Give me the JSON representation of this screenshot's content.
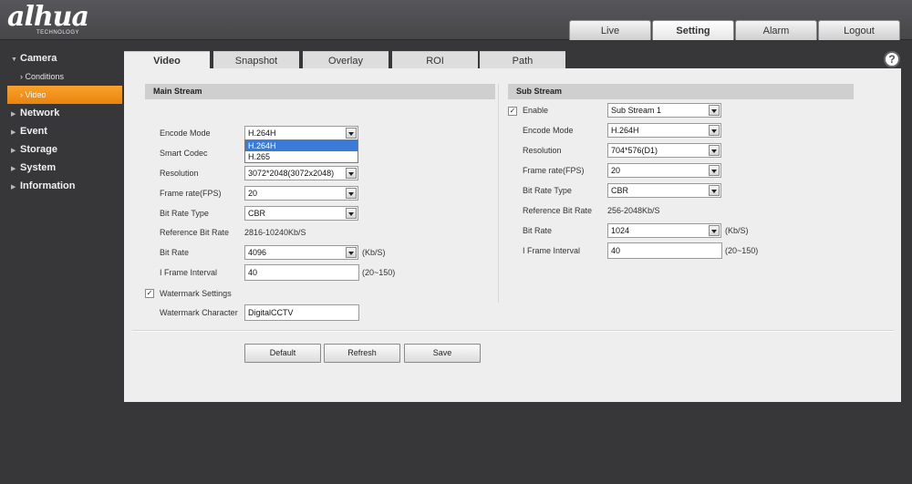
{
  "brand": {
    "logo": "alhua",
    "tagline": "TECHNOLOGY"
  },
  "top_nav": [
    "Live",
    "Setting",
    "Alarm",
    "Logout"
  ],
  "sidebar": {
    "camera": "Camera",
    "conditions": "Conditions",
    "video": "Video",
    "network": "Network",
    "event": "Event",
    "storage": "Storage",
    "system": "System",
    "information": "Information"
  },
  "tabs": [
    "Video",
    "Snapshot",
    "Overlay",
    "ROI",
    "Path"
  ],
  "help": "?",
  "main_stream": {
    "title": "Main Stream",
    "encode_mode_label": "Encode Mode",
    "encode_mode_value": "H.264H",
    "encode_options": [
      "H.264H",
      "H.265"
    ],
    "smart_codec_label": "Smart Codec",
    "resolution_label": "Resolution",
    "resolution_value": "3072*2048(3072x2048)",
    "frame_rate_label": "Frame rate(FPS)",
    "frame_rate_value": "20",
    "bit_rate_type_label": "Bit Rate Type",
    "bit_rate_type_value": "CBR",
    "ref_bit_rate_label": "Reference Bit Rate",
    "ref_bit_rate_value": "2816-10240Kb/S",
    "bit_rate_label": "Bit Rate",
    "bit_rate_value": "4096",
    "bit_rate_unit": "(Kb/S)",
    "iframe_label": "I Frame Interval",
    "iframe_value": "40",
    "iframe_range": "(20~150)",
    "watermark_settings_label": "Watermark Settings",
    "watermark_char_label": "Watermark Character",
    "watermark_char_value": "DigitalCCTV"
  },
  "sub_stream": {
    "title": "Sub Stream",
    "enable_label": "Enable",
    "stream_value": "Sub Stream 1",
    "encode_mode_label": "Encode Mode",
    "encode_mode_value": "H.264H",
    "resolution_label": "Resolution",
    "resolution_value": "704*576(D1)",
    "frame_rate_label": "Frame rate(FPS)",
    "frame_rate_value": "20",
    "bit_rate_type_label": "Bit Rate Type",
    "bit_rate_type_value": "CBR",
    "ref_bit_rate_label": "Reference Bit Rate",
    "ref_bit_rate_value": "256-2048Kb/S",
    "bit_rate_label": "Bit Rate",
    "bit_rate_value": "1024",
    "bit_rate_unit": "(Kb/S)",
    "iframe_label": "I Frame Interval",
    "iframe_value": "40",
    "iframe_range": "(20~150)"
  },
  "buttons": {
    "default": "Default",
    "refresh": "Refresh",
    "save": "Save"
  },
  "check_mark": "✓",
  "colors": {
    "accent": "#ef8f15",
    "header": "#4f4f52",
    "panel": "#eeeeee"
  }
}
